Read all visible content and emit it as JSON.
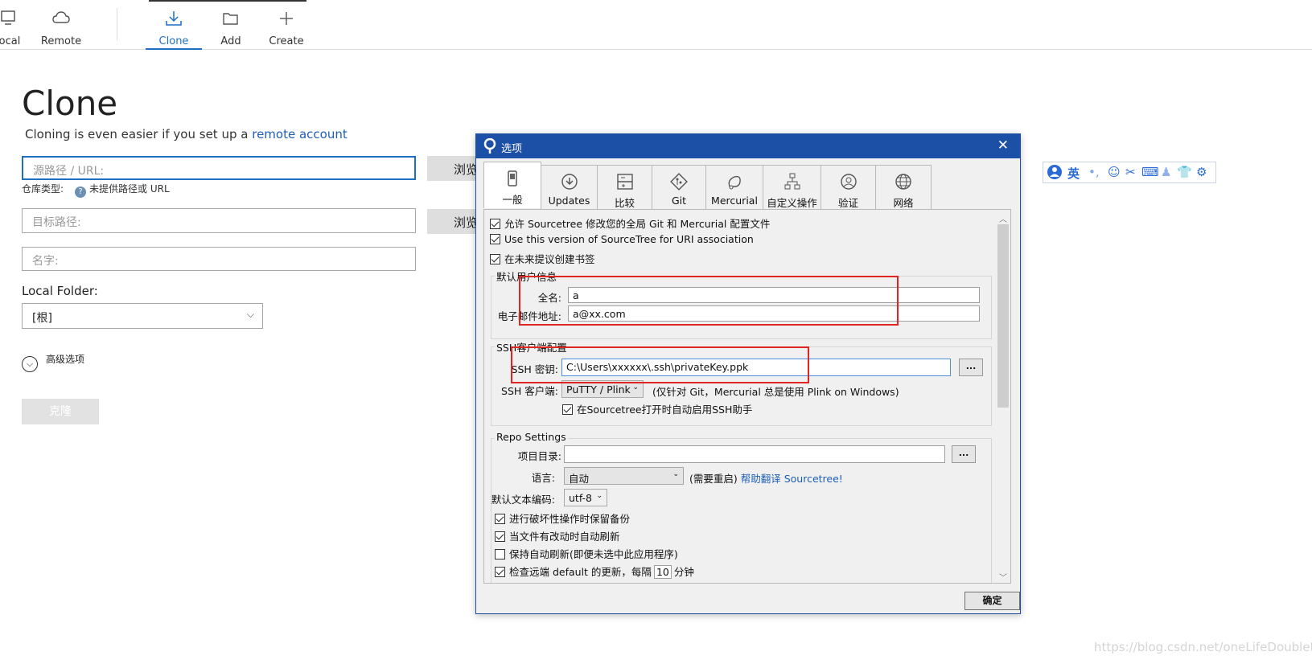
{
  "toolbar": {
    "items": [
      {
        "label": "ocal",
        "icon": "monitor-icon"
      },
      {
        "label": "Remote",
        "icon": "cloud-icon"
      },
      {
        "label": "Clone",
        "icon": "download-icon",
        "active": true
      },
      {
        "label": "Add",
        "icon": "folder-icon"
      },
      {
        "label": "Create",
        "icon": "plus-icon"
      }
    ]
  },
  "clone": {
    "title": "Clone",
    "subtitle_text": "Cloning is even easier if you set up a",
    "subtitle_link": "remote account",
    "source_placeholder": "源路径 / URL:",
    "repo_type_label": "仓库类型:",
    "repo_type_value": "未提供路径或 URL",
    "browse_label": "浏览",
    "dest_placeholder": "目标路径:",
    "name_placeholder": "名字:",
    "local_folder_label": "Local Folder:",
    "local_folder_value": "[根]",
    "advanced_label": "高级选项",
    "clone_button": "克隆"
  },
  "ime": {
    "mode": "英",
    "punct": "•,",
    "icons": [
      "smiley-icon",
      "scissors-icon",
      "keyboard-icon",
      "person-icon",
      "shirt-icon",
      "gear-icon"
    ]
  },
  "watermark": "https://blog.csdn.net/oneLifeDoubleL",
  "dialog": {
    "title": "选项",
    "close": "✕",
    "tabs": [
      {
        "label": "一般",
        "icon": "phone-icon",
        "active": true
      },
      {
        "label": "Updates",
        "icon": "update-icon"
      },
      {
        "label": "比较",
        "icon": "compare-icon"
      },
      {
        "label": "Git",
        "icon": "git-icon"
      },
      {
        "label": "Mercurial",
        "icon": "mercurial-icon"
      },
      {
        "label": "自定义操作",
        "icon": "custom-actions-icon"
      },
      {
        "label": "验证",
        "icon": "auth-icon"
      },
      {
        "label": "网络",
        "icon": "network-icon"
      }
    ],
    "checks_top": [
      {
        "label": "允许 Sourcetree 修改您的全局 Git 和 Mercurial 配置文件",
        "checked": true
      },
      {
        "label": "Use this version of SourceTree for URI association",
        "checked": true
      },
      {
        "label": "在未来提议创建书签",
        "checked": true
      }
    ],
    "user_info": {
      "group_label": "默认用户信息",
      "fullname_label": "全名:",
      "fullname_value": "a",
      "email_label": "电子邮件地址:",
      "email_value": "a@xx.com"
    },
    "ssh": {
      "group_label": "SSH客户端配置",
      "key_label": "SSH 密钥:",
      "key_value": "C:\\Users\\xxxxxx\\.ssh\\privateKey.ppk",
      "client_label": "SSH 客户端:",
      "client_value": "PuTTY / Plink",
      "client_note": "(仅针对 Git，Mercurial 总是使用 Plink on Windows)",
      "agent_label": "在Sourcetree打开时自动启用SSH助手",
      "agent_checked": true
    },
    "repo": {
      "group_label": "Repo Settings",
      "project_dir_label": "项目目录:",
      "project_dir_value": "",
      "language_label": "语言:",
      "language_value": "自动",
      "language_note": "(需要重启)",
      "language_link": "帮助翻译 Sourcetree!",
      "encoding_label": "默认文本编码:",
      "encoding_value": "utf-8",
      "checks": [
        {
          "label": "进行破坏性操作时保留备份",
          "checked": true
        },
        {
          "label": "当文件有改动时自动刷新",
          "checked": true
        },
        {
          "label": "保持自动刷新(即便未选中此应用程序)",
          "checked": false
        }
      ],
      "remote_check_prefix": "检查远端 default 的更新，每隔",
      "remote_check_value": "10",
      "remote_check_suffix": "分钟",
      "remote_check_checked": true
    },
    "ok_button": "确定",
    "browse_dots": "..."
  }
}
